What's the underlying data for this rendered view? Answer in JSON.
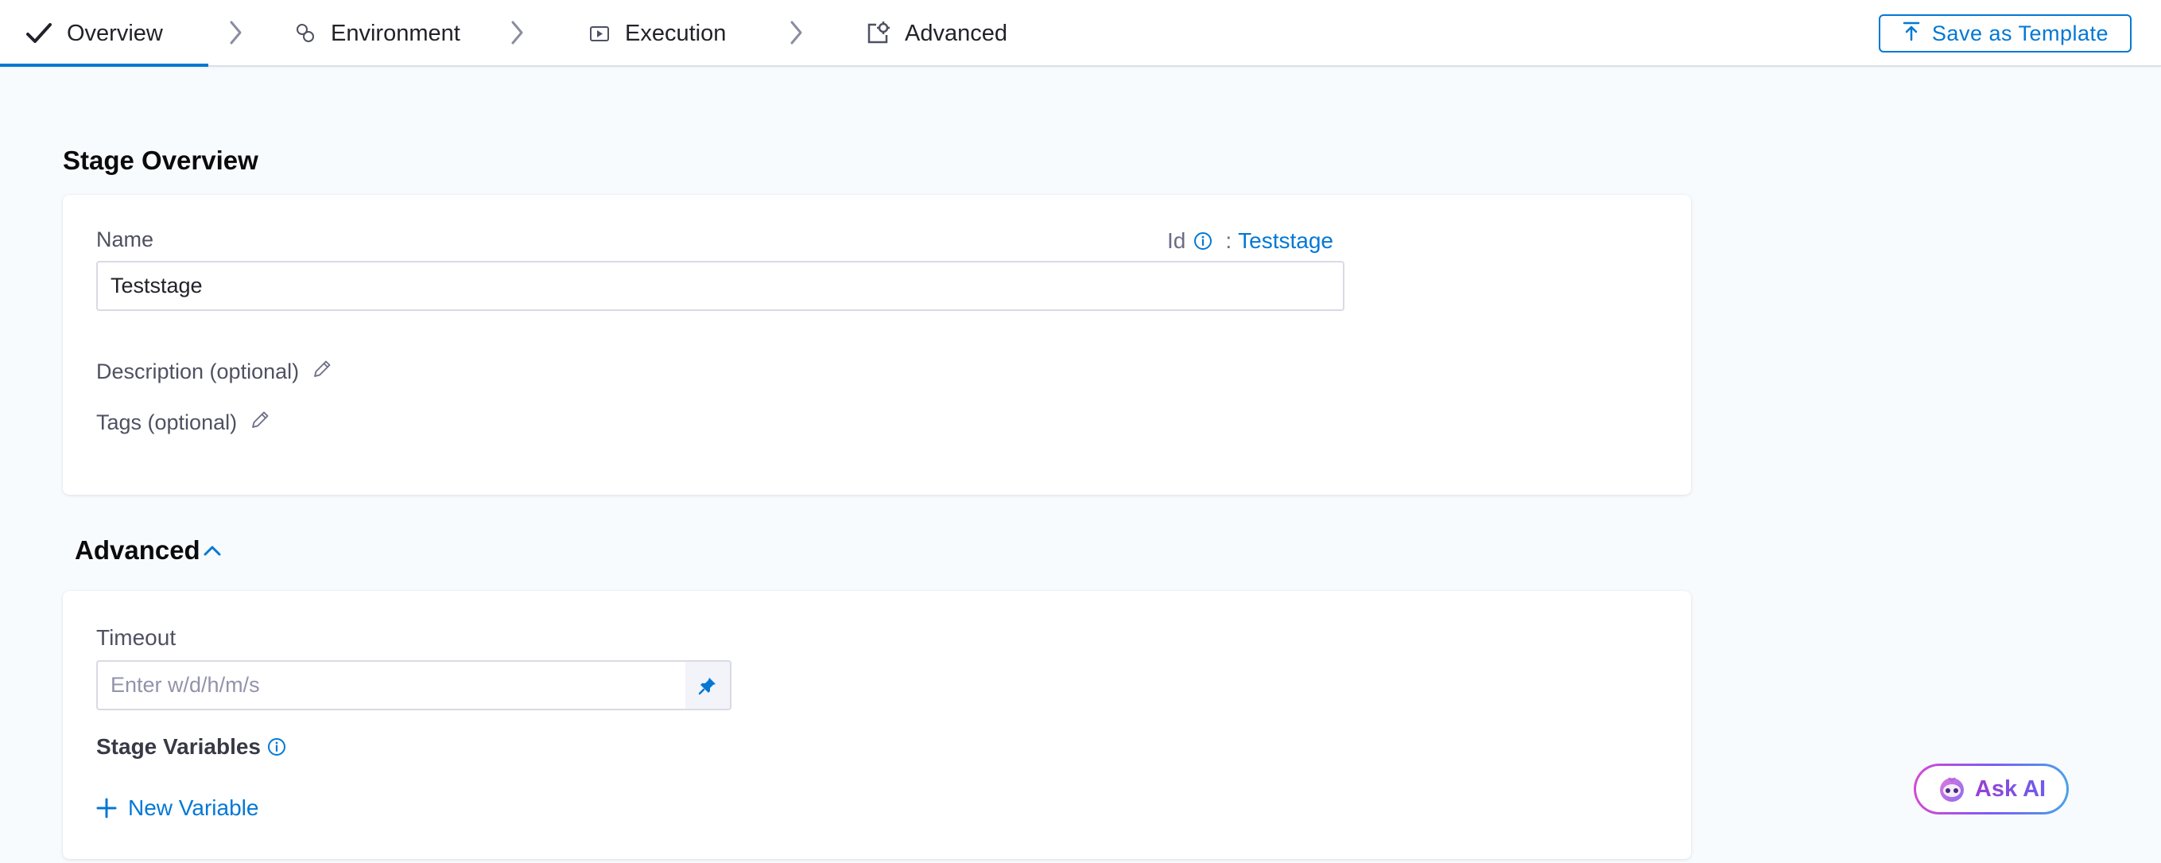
{
  "tabs": [
    {
      "label": "Overview",
      "icon": "check-icon",
      "active": true
    },
    {
      "label": "Environment",
      "icon": "environment-icon",
      "active": false
    },
    {
      "label": "Execution",
      "icon": "execution-icon",
      "active": false
    },
    {
      "label": "Advanced",
      "icon": "advanced-settings-icon",
      "active": false
    }
  ],
  "toolbar": {
    "save_template_label": "Save as Template",
    "save_template_icon": "upload-icon"
  },
  "overview": {
    "title": "Stage Overview",
    "name_label": "Name",
    "name_value": "Teststage",
    "id_label": "Id",
    "id_separator": ":",
    "id_value": "Teststage",
    "description_label": "Description (optional)",
    "tags_label": "Tags (optional)"
  },
  "advanced": {
    "title": "Advanced",
    "timeout_label": "Timeout",
    "timeout_placeholder": "Enter w/d/h/m/s",
    "stage_variables_label": "Stage Variables",
    "new_variable_label": "New Variable"
  },
  "ask_ai": {
    "label": "Ask AI"
  },
  "colors": {
    "accent": "#0278d5",
    "active_tab_underline": "#0278d5"
  }
}
